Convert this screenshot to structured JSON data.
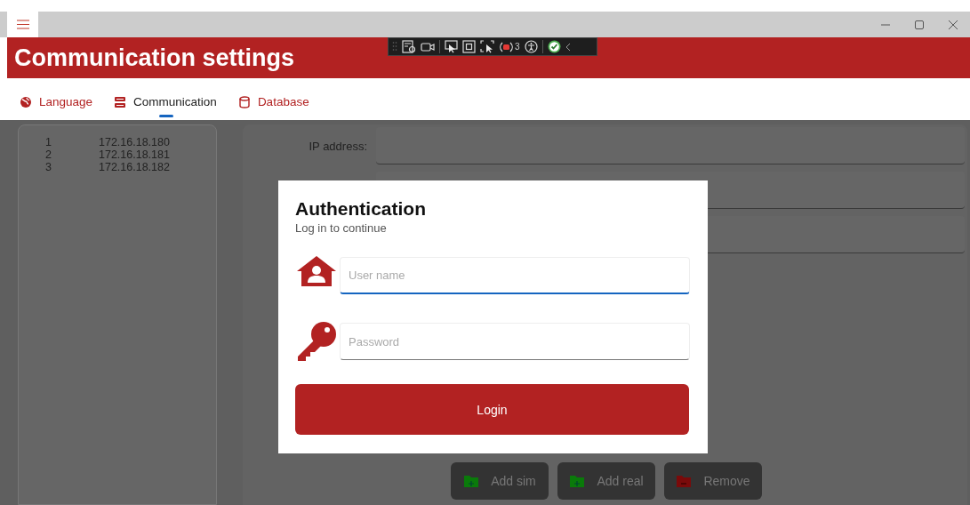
{
  "window": {
    "controls": [
      {
        "kind": "minimize"
      },
      {
        "kind": "maximize"
      },
      {
        "kind": "close"
      }
    ]
  },
  "header": {
    "title": "Communication settings"
  },
  "debug_toolbar": {
    "badge": "3"
  },
  "tabs": [
    {
      "label": "Language",
      "kind": "globe",
      "selected": false
    },
    {
      "label": "Communication",
      "kind": "server",
      "selected": true
    },
    {
      "label": "Database",
      "kind": "database",
      "selected": false
    }
  ],
  "servers": [
    {
      "index": "1",
      "address": "172.16.18.180"
    },
    {
      "index": "2",
      "address": "172.16.18.181"
    },
    {
      "index": "3",
      "address": "172.16.18.182"
    }
  ],
  "form": {
    "fields": [
      {
        "kind": "labeled",
        "label": "IP address:"
      },
      {
        "kind": "plain"
      },
      {
        "kind": "plain"
      }
    ]
  },
  "buttons": [
    {
      "label": "Add sim",
      "kind": "add"
    },
    {
      "label": "Add real",
      "kind": "add"
    },
    {
      "label": "Remove",
      "kind": "remove"
    }
  ],
  "dialog": {
    "title": "Authentication",
    "subtitle": "Log in to continue",
    "fields": [
      {
        "kind": "user",
        "placeholder": "User name",
        "focused": true
      },
      {
        "kind": "password",
        "placeholder": "Password",
        "focused": false
      }
    ],
    "button": "Login"
  }
}
